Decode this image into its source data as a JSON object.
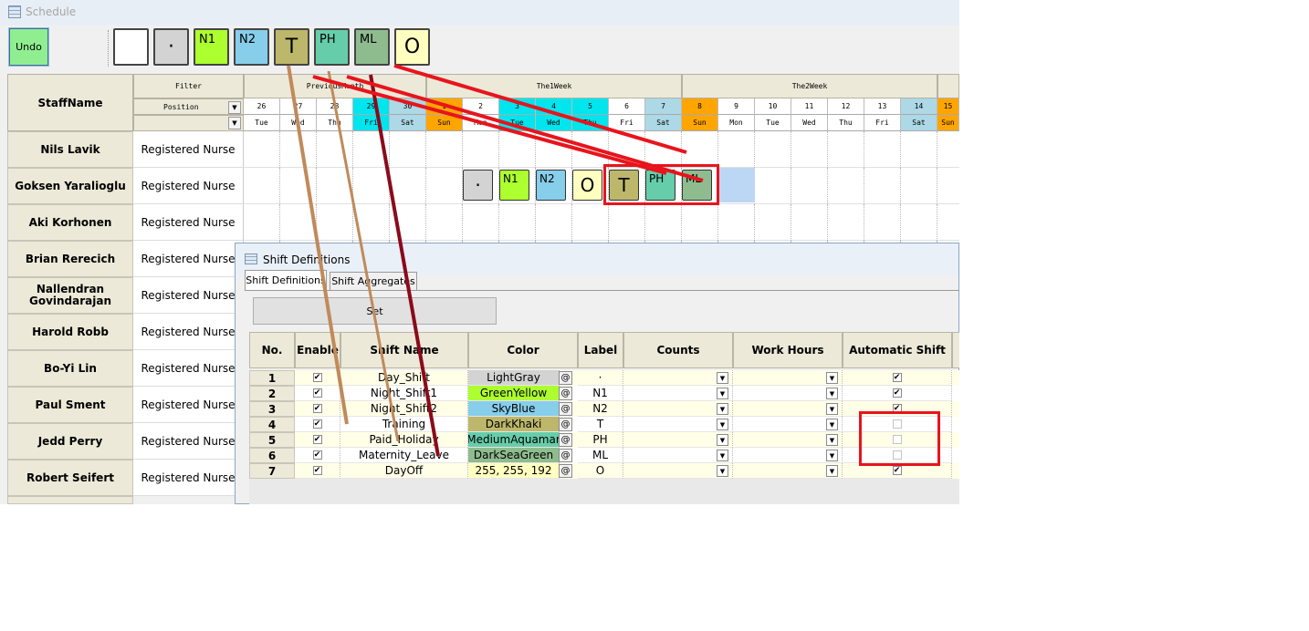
{
  "window": {
    "title": "Schedule"
  },
  "toolbar": {
    "undo_label": "Undo",
    "shift_buttons": [
      {
        "label": "",
        "color": "#ffffff"
      },
      {
        "label": "·",
        "color": "#d3d3d3"
      },
      {
        "label": "N1",
        "color": "#adff2f"
      },
      {
        "label": "N2",
        "color": "#87ceeb"
      },
      {
        "label": "T",
        "color": "#bdb76b"
      },
      {
        "label": "PH",
        "color": "#66cdaa"
      },
      {
        "label": "ML",
        "color": "#8fbc8f"
      },
      {
        "label": "O",
        "color": "#ffffc0"
      }
    ]
  },
  "grid": {
    "staffname_header": "StaffName",
    "filter_header": "Filter",
    "position_header": "Position",
    "week_headers": [
      "PreviousMonth",
      "The1Week",
      "The2Week"
    ],
    "days": [
      {
        "num": "26",
        "dow": "Tue",
        "color": "#ffffff"
      },
      {
        "num": "27",
        "dow": "Wed",
        "color": "#ffffff"
      },
      {
        "num": "28",
        "dow": "Thu",
        "color": "#ffffff"
      },
      {
        "num": "29",
        "dow": "Fri",
        "color": "#00e5ee"
      },
      {
        "num": "30",
        "dow": "Sat",
        "color": "#add8e6"
      },
      {
        "num": "1",
        "dow": "Sun",
        "color": "#ffa500"
      },
      {
        "num": "2",
        "dow": "Mon",
        "color": "#ffffff"
      },
      {
        "num": "3",
        "dow": "Tue",
        "color": "#00e5ee"
      },
      {
        "num": "4",
        "dow": "Wed",
        "color": "#00e5ee"
      },
      {
        "num": "5",
        "dow": "Thu",
        "color": "#00e5ee"
      },
      {
        "num": "6",
        "dow": "Fri",
        "color": "#ffffff"
      },
      {
        "num": "7",
        "dow": "Sat",
        "color": "#add8e6"
      },
      {
        "num": "8",
        "dow": "Sun",
        "color": "#ffa500"
      },
      {
        "num": "9",
        "dow": "Mon",
        "color": "#ffffff"
      },
      {
        "num": "10",
        "dow": "Tue",
        "color": "#ffffff"
      },
      {
        "num": "11",
        "dow": "Wed",
        "color": "#ffffff"
      },
      {
        "num": "12",
        "dow": "Thu",
        "color": "#ffffff"
      },
      {
        "num": "13",
        "dow": "Fri",
        "color": "#ffffff"
      },
      {
        "num": "14",
        "dow": "Sat",
        "color": "#add8e6"
      },
      {
        "num": "15",
        "dow": "Sun",
        "color": "#ffa500"
      }
    ],
    "staff": [
      {
        "name": "Nils Lavik",
        "position": "Registered Nurse"
      },
      {
        "name": "Goksen Yaralioglu",
        "position": "Registered Nurse"
      },
      {
        "name": "Aki Korhonen",
        "position": "Registered Nurse"
      },
      {
        "name": "Brian Rerecich",
        "position": "Registered Nurse"
      },
      {
        "name": "Nallendran Govindarajan",
        "position": "Registered Nurse"
      },
      {
        "name": "Harold Robb",
        "position": "Registered Nurse"
      },
      {
        "name": "Bo-Yi Lin",
        "position": "Registered Nurse"
      },
      {
        "name": "Paul Sment",
        "position": "Registered Nurse"
      },
      {
        "name": "Jedd Perry",
        "position": "Registered Nurse"
      },
      {
        "name": "Robert Seifert",
        "position": "Registered Nurse"
      }
    ],
    "popup_buttons": [
      {
        "label": "·",
        "color": "#d3d3d3"
      },
      {
        "label": "N1",
        "color": "#adff2f"
      },
      {
        "label": "N2",
        "color": "#87ceeb"
      },
      {
        "label": "O",
        "color": "#ffffc0"
      },
      {
        "label": "T",
        "color": "#bdb76b"
      },
      {
        "label": "PH",
        "color": "#66cdaa"
      },
      {
        "label": "ML",
        "color": "#8fbc8f"
      }
    ]
  },
  "dialog": {
    "title": "Shift Definitions",
    "tabs": [
      "Shift Definitions",
      "Shift Aggregates"
    ],
    "set_label": "Set",
    "columns": [
      "No.",
      "Enable",
      "Shift Name",
      "Color",
      "Label",
      "Counts",
      "Work Hours",
      "Automatic Shift"
    ],
    "color_button": "@",
    "rows": [
      {
        "no": "1",
        "enabled": true,
        "name": "Day_Shift",
        "color_name": "LightGray",
        "color": "#d3d3d3",
        "label": "·",
        "auto": true
      },
      {
        "no": "2",
        "enabled": true,
        "name": "Night_Shift1",
        "color_name": "GreenYellow",
        "color": "#adff2f",
        "label": "N1",
        "auto": true
      },
      {
        "no": "3",
        "enabled": true,
        "name": "Night_Shift2",
        "color_name": "SkyBlue",
        "color": "#87ceeb",
        "label": "N2",
        "auto": true
      },
      {
        "no": "4",
        "enabled": true,
        "name": "Training",
        "color_name": "DarkKhaki",
        "color": "#bdb76b",
        "label": "T",
        "auto": false
      },
      {
        "no": "5",
        "enabled": true,
        "name": "Paid_Holiday",
        "color_name": "MediumAquamar",
        "color": "#66cdaa",
        "label": "PH",
        "auto": false
      },
      {
        "no": "6",
        "enabled": true,
        "name": "Maternity_Leave",
        "color_name": "DarkSeaGreen",
        "color": "#8fbc8f",
        "label": "ML",
        "auto": false
      },
      {
        "no": "7",
        "enabled": true,
        "name": "DayOff",
        "color_name": "255, 255, 192",
        "color": "#ffffc0",
        "label": "O",
        "auto": true
      }
    ]
  },
  "annotations": {
    "highlight_color": "#e8141c"
  }
}
